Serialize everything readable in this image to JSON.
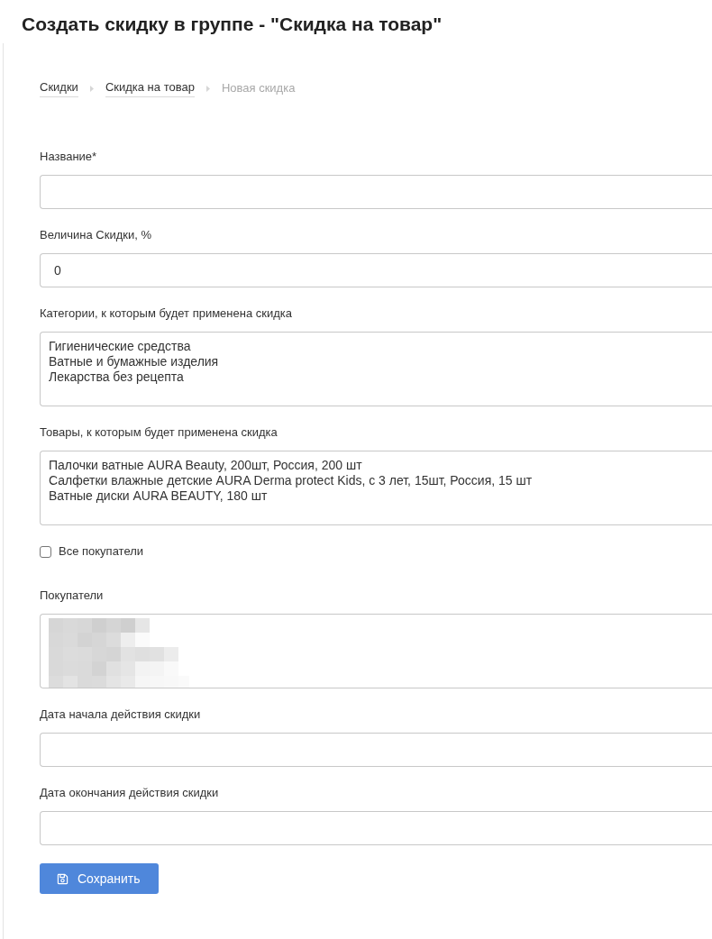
{
  "page": {
    "title": "Создать скидку в группе - \"Скидка на товар\""
  },
  "breadcrumb": [
    {
      "label": "Скидки",
      "current": false
    },
    {
      "label": "Скидка на товар",
      "current": false
    },
    {
      "label": "Новая скидка",
      "current": true
    }
  ],
  "form": {
    "fields": [
      {
        "kind": "input",
        "label": "Название*"
      },
      {
        "kind": "input",
        "label": "Величина Скидки, %",
        "value": "0"
      },
      {
        "kind": "list",
        "label": "Категории, к которым будет применена скидка",
        "items": [
          "Гигиенические средства",
          "Ватные и бумажные изделия",
          "Лекарства без рецепта"
        ]
      },
      {
        "kind": "list",
        "label": "Товары, к которым будет применена скидка",
        "items": [
          "Палочки ватные AURA Beauty, 200шт, Россия, 200 шт",
          "Салфетки влажные детские AURA Derma protect Kids, с 3 лет, 15шт, Россия, 15 шт",
          "Ватные диски AURA BEAUTY, 180 шт"
        ]
      },
      {
        "kind": "checkbox",
        "label": "Все покупатели",
        "checked": false
      },
      {
        "kind": "blurred_list",
        "label": "Покупатели"
      },
      {
        "kind": "input",
        "label": "Дата начала действия скидки"
      },
      {
        "kind": "input",
        "label": "Дата окончания действия скидки"
      }
    ],
    "submit": {
      "label": "Сохранить"
    }
  }
}
